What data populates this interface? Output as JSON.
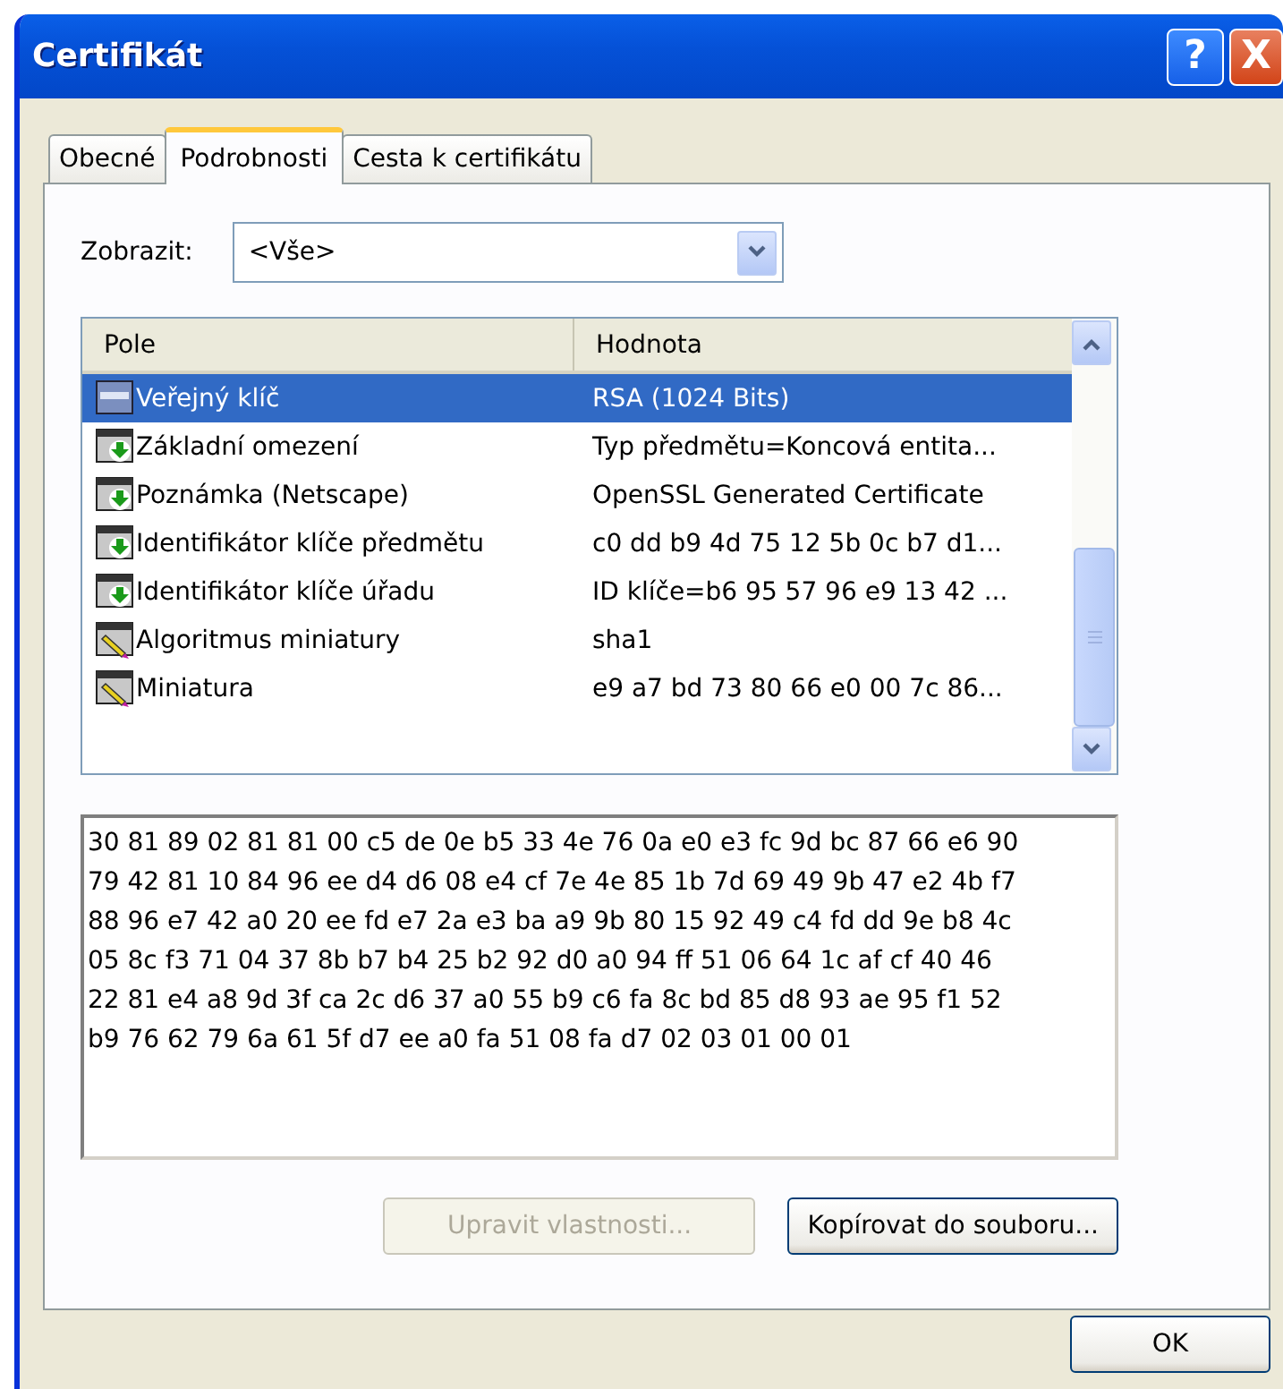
{
  "window": {
    "title": "Certifikát",
    "buttons": [
      "?",
      "X"
    ]
  },
  "tabs": [
    {
      "label": "Obecné",
      "selected": false
    },
    {
      "label": "Podrobnosti",
      "selected": true
    },
    {
      "label": "Cesta k certifikátu",
      "selected": false
    }
  ],
  "show": {
    "label": "Zobrazit:",
    "value": "<Vše>"
  },
  "table": {
    "columns": [
      "Pole",
      "Hodnota"
    ],
    "rows": [
      {
        "kind": "plain",
        "field": "Veřejný klíč",
        "value": "RSA (1024 Bits)",
        "selected": true
      },
      {
        "kind": "extension",
        "field": "Základní omezení",
        "value": "Typ předmětu=Koncová entita...",
        "selected": false
      },
      {
        "kind": "extension",
        "field": "Poznámka (Netscape)",
        "value": "OpenSSL Generated Certificate",
        "selected": false
      },
      {
        "kind": "extension",
        "field": "Identifikátor klíče předmětu",
        "value": "c0 dd b9 4d 75 12 5b 0c b7 d1...",
        "selected": false
      },
      {
        "kind": "extension",
        "field": "Identifikátor klíče úřadu",
        "value": "ID klíče=b6 95 57 96 e9 13 42 ...",
        "selected": false
      },
      {
        "kind": "property",
        "field": "Algoritmus miniatury",
        "value": "sha1",
        "selected": false
      },
      {
        "kind": "property",
        "field": "Miniatura",
        "value": "e9 a7 bd 73 80 66 e0 00 7c 86...",
        "selected": false
      }
    ]
  },
  "detail_lines": [
    "30 81 89 02 81 81 00 c5 de 0e b5 33 4e 76 0a e0 e3 fc 9d bc 87 66 e6 90",
    "79 42 81 10 84 96 ee d4 d6 08 e4 cf 7e 4e 85 1b 7d 69 49 9b 47 e2 4b f7",
    "88 96 e7 42 a0 20 ee fd e7 2a e3 ba a9 9b 80 15 92 49 c4 fd dd 9e b8 4c",
    "05 8c f3 71 04 37 8b b7 b4 25 b2 92 d0 a0 94 ff 51 06 64 1c af cf 40 46",
    "22 81 e4 a8 9d 3f ca 2c d6 37 a0 55 b9 c6 fa 8c bd 85 d8 93 ae 95 f1 52",
    "b9 76 62 79 6a 61 5f d7 ee a0 fa 51 08 fa d7 02 03 01 00 01"
  ],
  "panel_buttons": [
    {
      "label": "Upravit vlastnosti...",
      "disabled": true
    },
    {
      "label": "Kopírovat do souboru...",
      "disabled": false
    }
  ],
  "ok_button": "OK"
}
